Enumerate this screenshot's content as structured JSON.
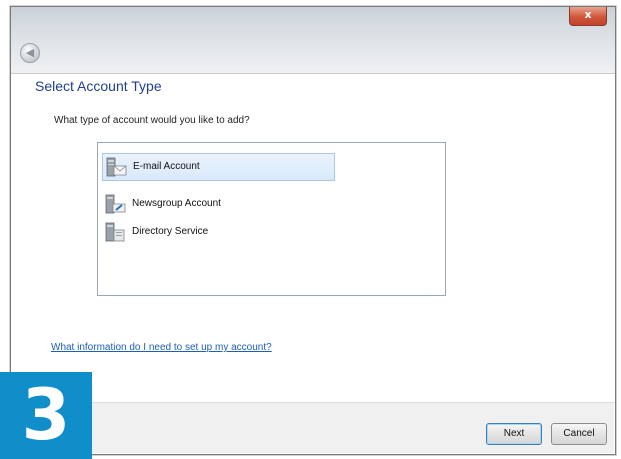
{
  "window": {
    "close_label": "x",
    "back_glyph": "◀"
  },
  "page": {
    "heading": "Select Account Type",
    "question": "What type of account would you like to add?"
  },
  "account_types": [
    {
      "label": "E-mail Account",
      "icon": "email-account-icon",
      "selected": true
    },
    {
      "label": "Newsgroup Account",
      "icon": "newsgroup-account-icon",
      "selected": false
    },
    {
      "label": "Directory Service",
      "icon": "directory-service-icon",
      "selected": false
    }
  ],
  "help_link": "What information do I need to set up my account?",
  "buttons": {
    "next": "Next",
    "cancel": "Cancel"
  },
  "step_badge": "3",
  "colors": {
    "heading": "#1f3f8f",
    "link": "#1b5fb8",
    "badge": "#0f8ec9",
    "selection": "#d9e9fb"
  }
}
